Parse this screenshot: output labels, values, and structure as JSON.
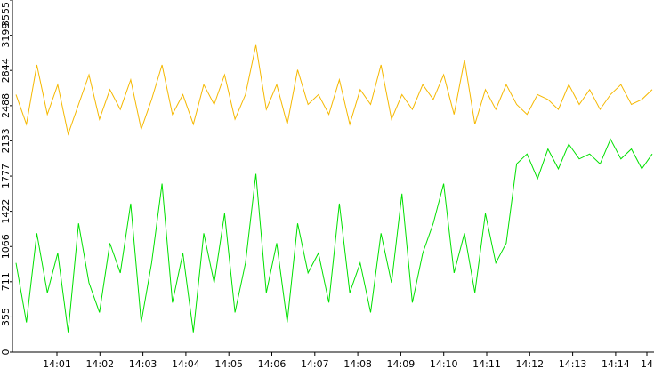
{
  "chart_data": {
    "type": "line",
    "title": "",
    "xlabel": "",
    "ylabel": "",
    "x_tick_labels": [
      "14:01",
      "14:02",
      "14:03",
      "14:04",
      "14:05",
      "14:06",
      "14:07",
      "14:08",
      "14:09",
      "14:10",
      "14:11",
      "14:12",
      "14:13",
      "14:14",
      "14"
    ],
    "y_tick_labels": [
      "0",
      "355",
      "711",
      "1066",
      "1422",
      "1777",
      "2133",
      "2488",
      "2844",
      "3199",
      "3555"
    ],
    "ylim": [
      0,
      3555
    ],
    "grid": false,
    "legend": "none",
    "series": [
      {
        "color": "#f5b800",
        "x_range": [
          "14:00:35",
          "14:14:45"
        ],
        "values": [
          2600,
          2300,
          2900,
          2400,
          2700,
          2200,
          2500,
          2800,
          2350,
          2650,
          2450,
          2750,
          2250,
          2550,
          2900,
          2400,
          2600,
          2300,
          2700,
          2500,
          2800,
          2350,
          2600,
          3100,
          2450,
          2700,
          2300,
          2850,
          2500,
          2600,
          2400,
          2750,
          2300,
          2650,
          2500,
          2900,
          2350,
          2600,
          2450,
          2700,
          2550,
          2800,
          2400,
          2950,
          2300,
          2650,
          2450,
          2700,
          2500,
          2400,
          2600,
          2550,
          2450,
          2700,
          2500,
          2650,
          2450,
          2600,
          2700,
          2500,
          2550,
          2650
        ]
      },
      {
        "color": "#00e000",
        "x_range": [
          "14:00:35",
          "14:14:45"
        ],
        "values": [
          900,
          300,
          1200,
          600,
          1000,
          200,
          1300,
          700,
          400,
          1100,
          800,
          1500,
          300,
          900,
          1700,
          500,
          1000,
          200,
          1200,
          700,
          1400,
          400,
          900,
          1800,
          600,
          1100,
          300,
          1300,
          800,
          1000,
          500,
          1500,
          600,
          900,
          400,
          1200,
          700,
          1600,
          500,
          1000,
          1300,
          1700,
          800,
          1200,
          600,
          1400,
          900,
          1100,
          1900,
          2000,
          1750,
          2050,
          1850,
          2100,
          1950,
          2000,
          1900,
          2150,
          1950,
          2050,
          1850,
          2000
        ]
      }
    ]
  }
}
